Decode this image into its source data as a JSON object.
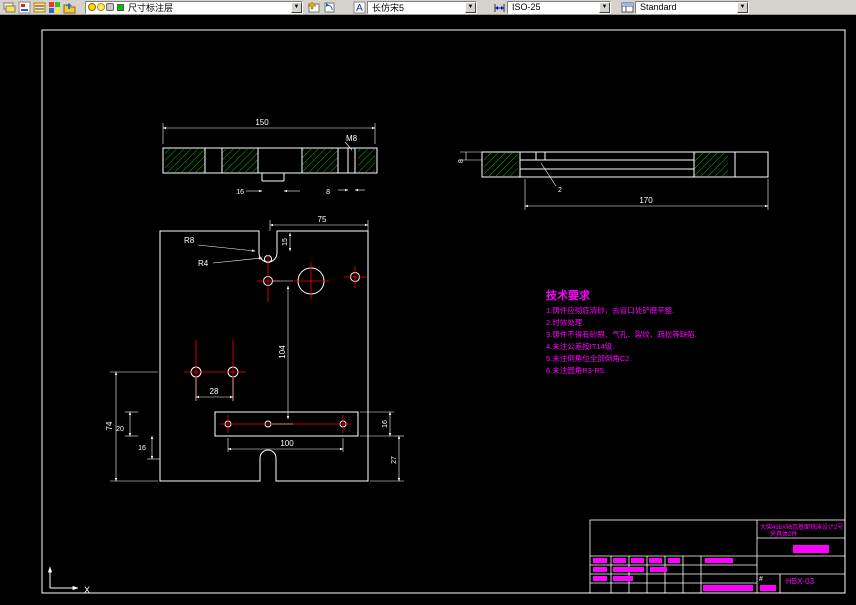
{
  "toolbar": {
    "layer_combo": {
      "value": "尺寸标注层"
    },
    "text_style_combo": {
      "value": "长仿宋5"
    },
    "dim_style_combo": {
      "value": "ISO-25"
    },
    "table_style_combo": {
      "value": "Standard"
    }
  },
  "colors": {
    "hatch": "#00bf00",
    "centerline": "#ff0000",
    "annotation": "#ff00ff",
    "geometry": "#ffffff"
  },
  "drawing": {
    "dims": {
      "top_width": "150",
      "thread": "M8",
      "tab_width": "16",
      "tab_hole": "8",
      "side_thickness": "8",
      "side_step": "2",
      "side_length": "170",
      "front_width": "75",
      "notch_radius": "R8",
      "inner_radius": "R4",
      "notch_depth": "15",
      "center_height": "104",
      "hole_spacing": "28",
      "left_height": "74",
      "left_a": "20",
      "left_b": "16",
      "slot_span": "100",
      "slot_height": "16",
      "bottom_offset": "27"
    },
    "tech_requirements": {
      "title": "技术要求",
      "items": [
        "1.铸件应彻底清砂，去冒口处铲磨平整.",
        "2.时效处理.",
        "3.铸件不得有砂眼、气孔、裂纹、疏松等缺陷.",
        "4.未注公差按IT14级.",
        "5.未注倒角位全部倒角C2.",
        "6.未注圆角R3-R5."
      ]
    },
    "ucs": {
      "x_label": "X"
    }
  },
  "title_block": {
    "project_line1": "大柴498X轴瓦基面铣床设计2号",
    "project_line2": "夹具体2件",
    "drawing_no": "HBX-03",
    "hash": "#"
  }
}
